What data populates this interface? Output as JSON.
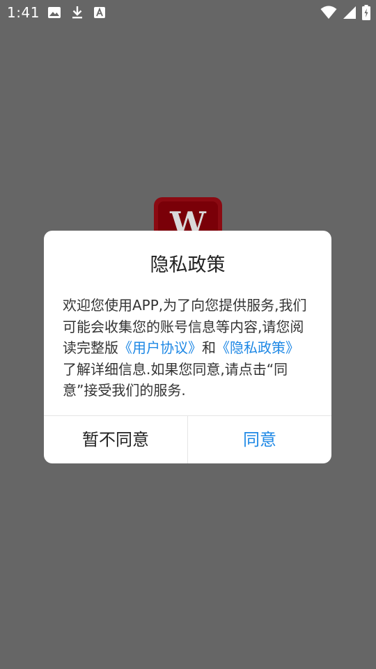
{
  "status_bar": {
    "time": "1:41",
    "icons_left": [
      "image-icon",
      "download-icon",
      "font-icon"
    ],
    "icons_right": [
      "wifi-icon",
      "signal-icon",
      "battery-icon"
    ]
  },
  "app_logo": {
    "letter": "W",
    "color": "#8b0a12"
  },
  "dialog": {
    "title": "隐私政策",
    "body_prefix": "欢迎您使用APP,为了向您提供服务,我们可能会收集您的账号信息等内容,请您阅读完整版",
    "link_user_agreement": "《用户协议》",
    "body_and": "和",
    "link_privacy_policy": "《隐私政策》",
    "body_suffix": "了解详细信息.如果您同意,请点击“同意”接受我们的服务.",
    "disagree_label": "暂不同意",
    "agree_label": "同意",
    "link_color": "#1e88e5"
  }
}
